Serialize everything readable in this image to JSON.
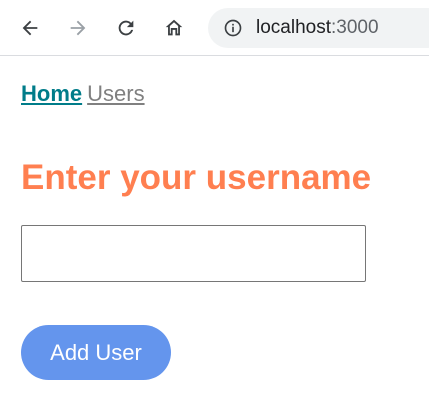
{
  "browser": {
    "url_host": "localhost",
    "url_port": ":3000",
    "icons": {
      "back": "back-arrow-icon",
      "forward": "forward-arrow-icon",
      "reload": "reload-icon",
      "home": "home-icon",
      "info": "info-icon"
    }
  },
  "nav": {
    "home_label": "Home",
    "users_label": "Users"
  },
  "main": {
    "heading": "Enter your username",
    "input_value": "",
    "button_label": "Add User"
  },
  "colors": {
    "heading": "#ff7f50",
    "button": "#6495ed",
    "home_link": "#007c89",
    "users_link": "#808080"
  }
}
